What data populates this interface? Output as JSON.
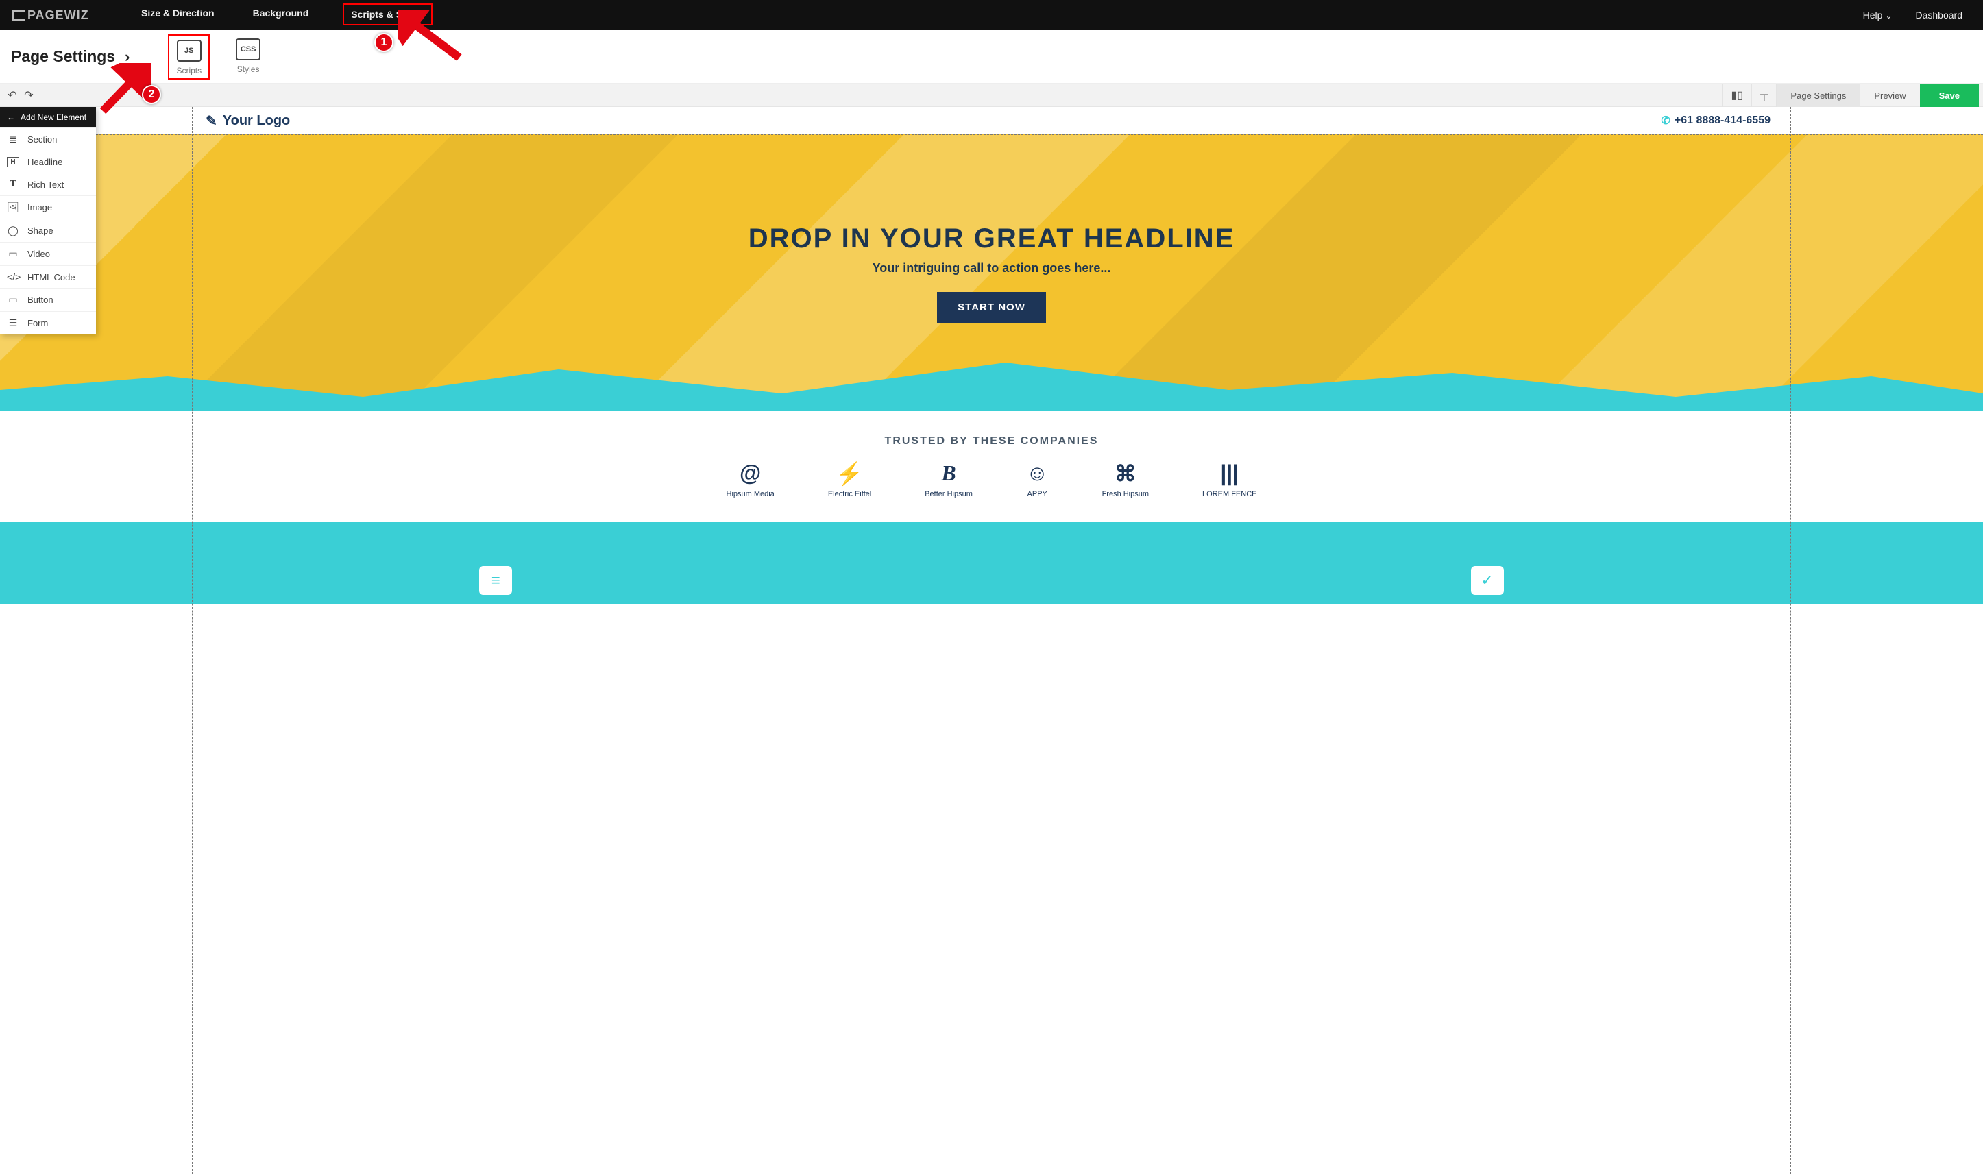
{
  "brand": "PAGEWIZ",
  "topnav": {
    "tabs": [
      "Size & Direction",
      "Background",
      "Scripts & Styles"
    ],
    "active_index": 2,
    "help": "Help",
    "dashboard": "Dashboard"
  },
  "settings": {
    "title": "Page Settings",
    "tools": [
      {
        "code": "JS",
        "label": "Scripts",
        "highlight": true
      },
      {
        "code": "CSS",
        "label": "Styles",
        "highlight": false
      }
    ]
  },
  "toolbar": {
    "page_settings": "Page Settings",
    "preview": "Preview",
    "save": "Save"
  },
  "elements_panel": {
    "title": "Add New Element",
    "items": [
      {
        "icon": "≣",
        "label": "Section"
      },
      {
        "icon": "H",
        "label": "Headline"
      },
      {
        "icon": "T",
        "label": "Rich Text"
      },
      {
        "icon": "🖼",
        "label": "Image"
      },
      {
        "icon": "◯",
        "label": "Shape"
      },
      {
        "icon": "▭",
        "label": "Video"
      },
      {
        "icon": "</>",
        "label": "HTML Code"
      },
      {
        "icon": "▭",
        "label": "Button"
      },
      {
        "icon": "☰",
        "label": "Form"
      }
    ]
  },
  "page": {
    "logo_text": "Your Logo",
    "phone": "+61 8888-414-6559",
    "hero": {
      "headline": "DROP IN YOUR GREAT HEADLINE",
      "sub": "Your intriguing call to action goes here...",
      "cta": "START NOW"
    },
    "trusted_title": "TRUSTED BY THESE COMPANIES",
    "companies": [
      {
        "glyph": "@",
        "name": "Hipsum Media"
      },
      {
        "glyph": "⚡",
        "name": "Electric Eiffel"
      },
      {
        "glyph": "B",
        "name": "Better Hipsum"
      },
      {
        "glyph": "☺",
        "name": "APPY"
      },
      {
        "glyph": "⌘",
        "name": "Fresh Hipsum"
      },
      {
        "glyph": "|||",
        "name": "LOREM FENCE"
      }
    ]
  },
  "annotations": {
    "badge1": "1",
    "badge2": "2"
  }
}
